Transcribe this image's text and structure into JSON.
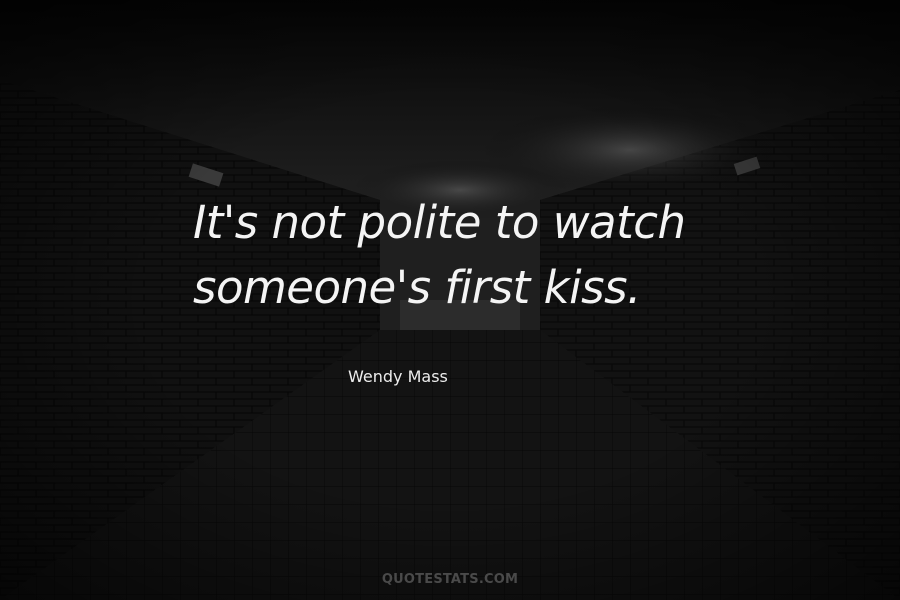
{
  "quote": {
    "lines": [
      "It's not polite to watch",
      "someone's first kiss."
    ],
    "author": "Wendy Mass"
  },
  "watermark": "QUOTESTATS.COM",
  "colors": {
    "background": "#0e0e0e",
    "text": "#f4f4f4",
    "watermark": "#4a4a4a"
  },
  "background_description_icon": "dark-brick-tunnel"
}
